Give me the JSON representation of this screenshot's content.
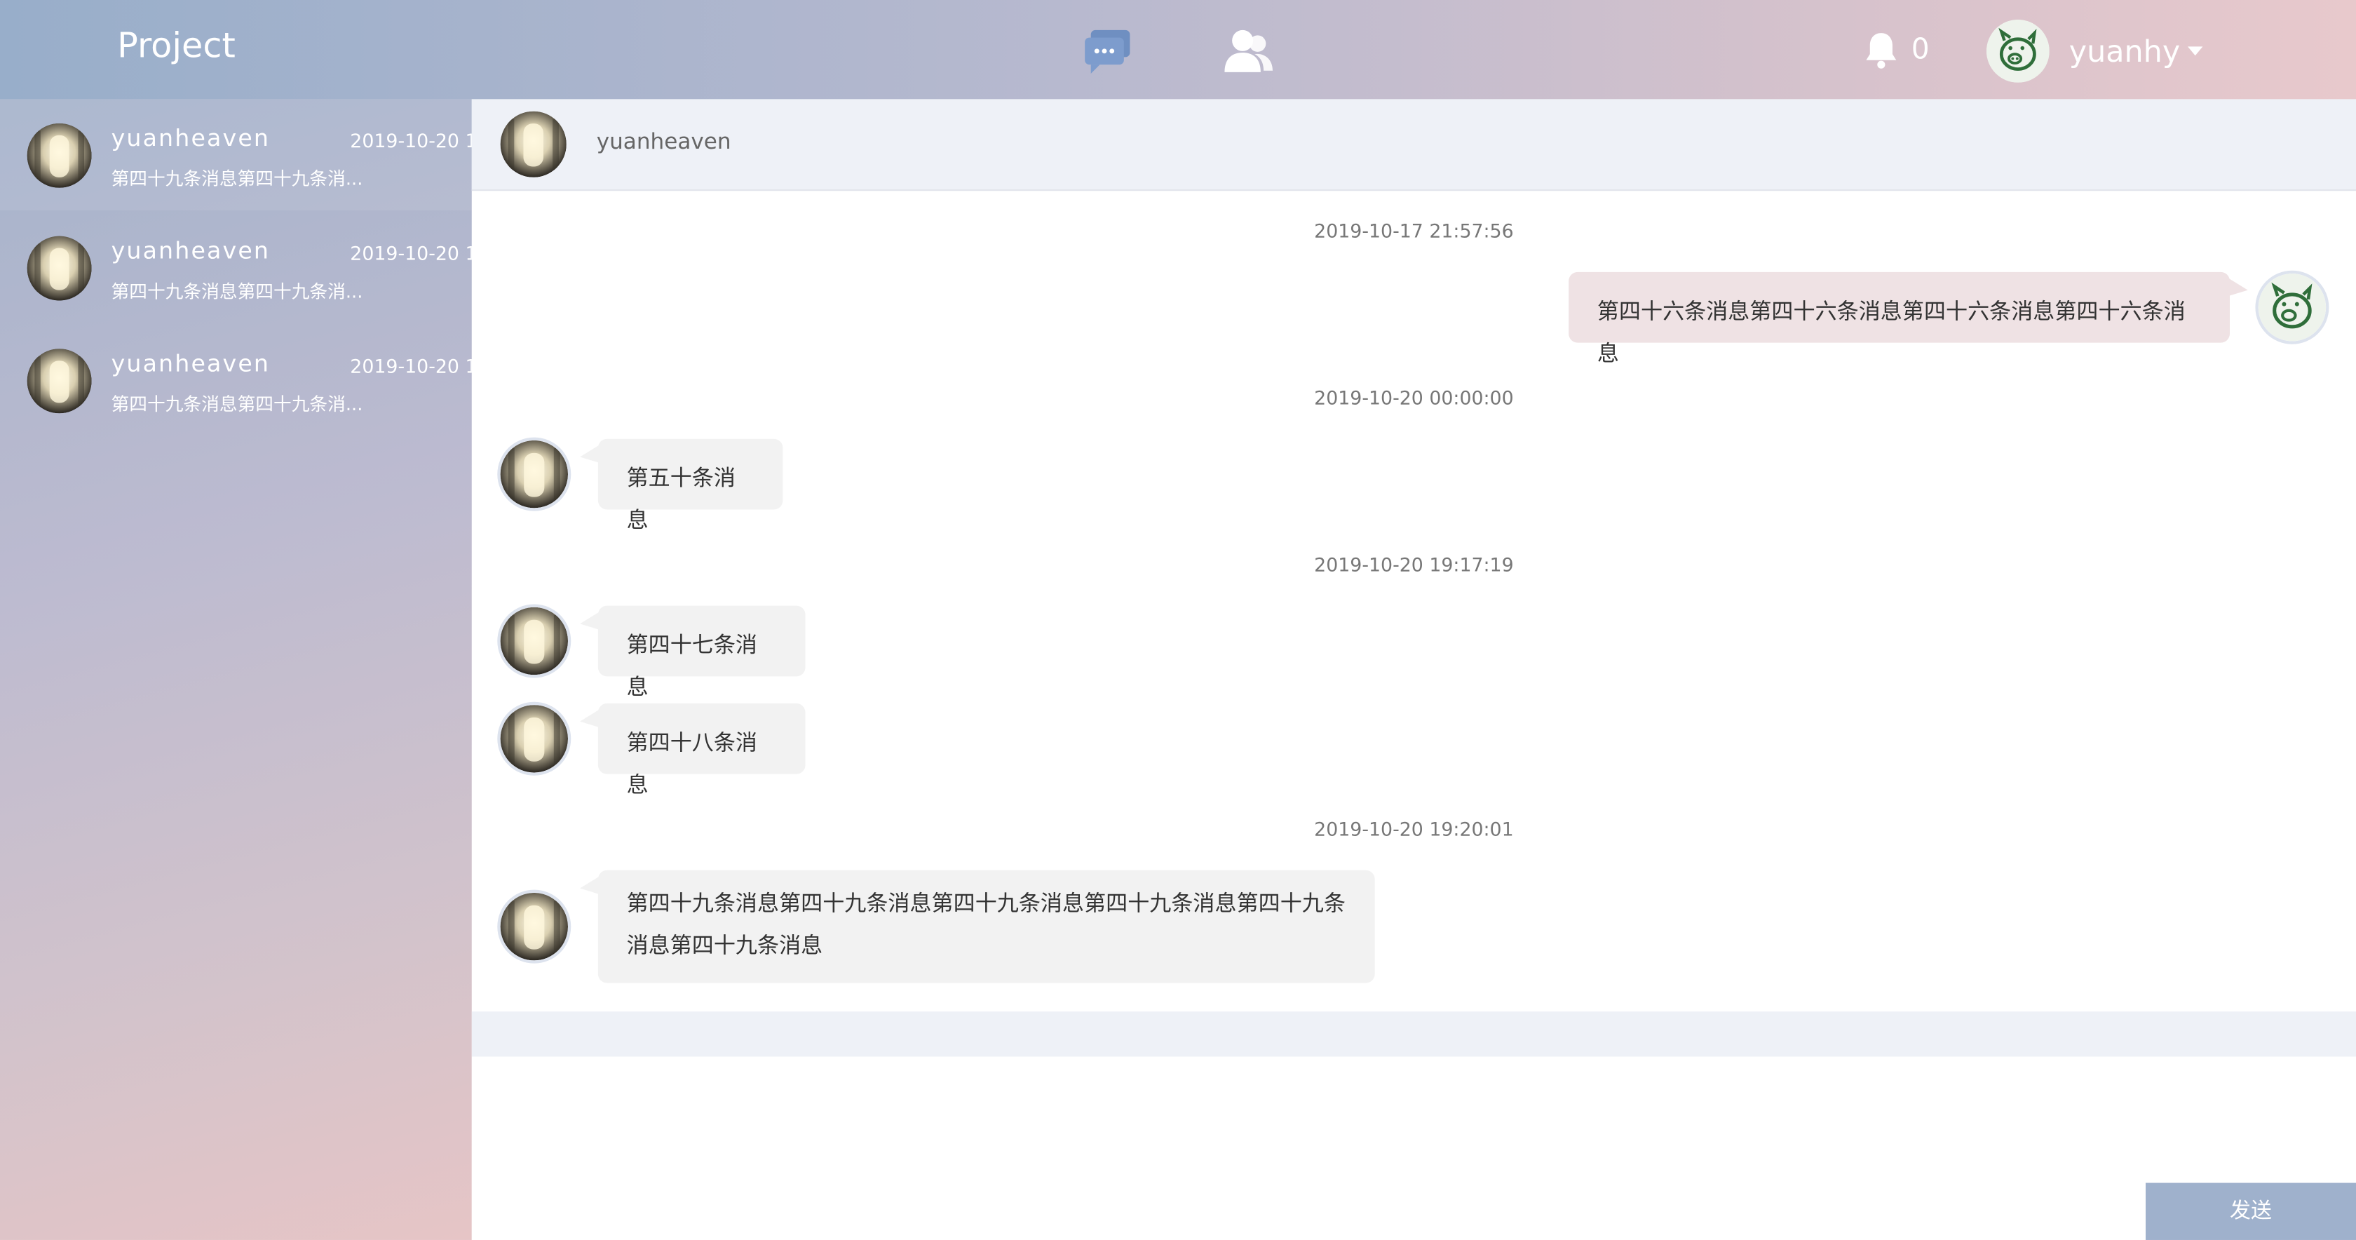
{
  "header": {
    "brand": "Project",
    "notification_count": "0",
    "username": "yuanhy"
  },
  "sidebar": {
    "conversations": [
      {
        "name": "yuanheaven",
        "date": "2019-10-20 1",
        "preview": "第四十九条消息第四十九条消..."
      },
      {
        "name": "yuanheaven",
        "date": "2019-10-20 1",
        "preview": "第四十九条消息第四十九条消..."
      },
      {
        "name": "yuanheaven",
        "date": "2019-10-20 1",
        "preview": "第四十九条消息第四十九条消..."
      }
    ]
  },
  "chat": {
    "title": "yuanheaven",
    "timestamps": [
      "2019-10-17 21:57:56",
      "2019-10-20 00:00:00",
      "2019-10-20 19:17:19",
      "2019-10-20 19:20:01"
    ],
    "messages": [
      {
        "side": "right",
        "text": "第四十六条消息第四十六条消息第四十六条消息第四十六条消息"
      },
      {
        "side": "left",
        "text": "第五十条消息"
      },
      {
        "side": "left",
        "text": "第四十七条消息"
      },
      {
        "side": "left",
        "text": "第四十八条消息"
      },
      {
        "side": "left",
        "text": "第四十九条消息第四十九条消息第四十九条消息第四十九条消息第四十九条消息第四十九条消息"
      }
    ],
    "send_label": "发送"
  },
  "colors": {
    "accent": "#9fb1cc",
    "bubble_other": "#f2f2f2",
    "bubble_self": "#efe2e4"
  }
}
